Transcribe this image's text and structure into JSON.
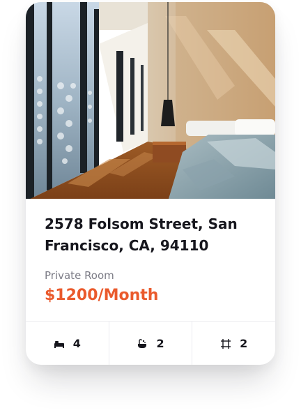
{
  "listing": {
    "address": "2578 Folsom Street, San Francisco, CA, 94110",
    "room_type": "Private Room",
    "price": "$1200/Month",
    "price_color": "#ea5a2c"
  },
  "features": [
    {
      "icon": "bed-icon",
      "value": "4"
    },
    {
      "icon": "bathtub-icon",
      "value": "2"
    },
    {
      "icon": "area-icon",
      "value": "2"
    }
  ]
}
